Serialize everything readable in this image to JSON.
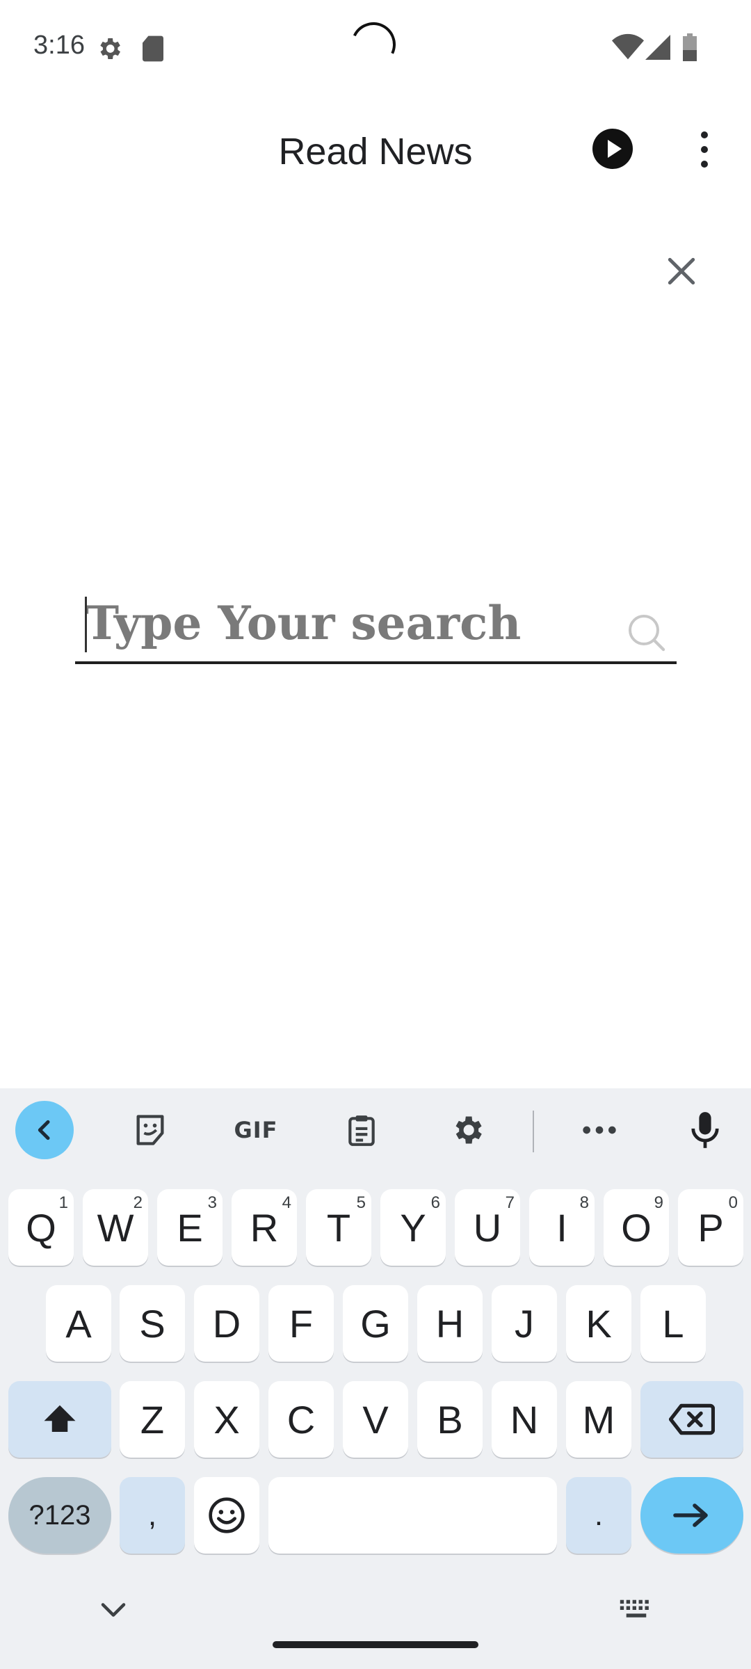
{
  "status_bar": {
    "time": "3:16"
  },
  "app_bar": {
    "title": "Read News"
  },
  "search": {
    "placeholder": "Type Your search",
    "value": ""
  },
  "keyboard": {
    "toolbar": {
      "gif_label": "GIF"
    },
    "row1": [
      {
        "label": "Q",
        "hint": "1"
      },
      {
        "label": "W",
        "hint": "2"
      },
      {
        "label": "E",
        "hint": "3"
      },
      {
        "label": "R",
        "hint": "4"
      },
      {
        "label": "T",
        "hint": "5"
      },
      {
        "label": "Y",
        "hint": "6"
      },
      {
        "label": "U",
        "hint": "7"
      },
      {
        "label": "I",
        "hint": "8"
      },
      {
        "label": "O",
        "hint": "9"
      },
      {
        "label": "P",
        "hint": "0"
      }
    ],
    "row2": [
      "A",
      "S",
      "D",
      "F",
      "G",
      "H",
      "J",
      "K",
      "L"
    ],
    "row3": [
      "Z",
      "X",
      "C",
      "V",
      "B",
      "N",
      "M"
    ],
    "row4": {
      "symbols_label": "?123",
      "comma_label": ",",
      "period_label": "."
    }
  },
  "colors": {
    "accent": "#6cc8f5",
    "modifier_key": "#d3e3f3",
    "keyboard_bg": "#eef0f3"
  }
}
